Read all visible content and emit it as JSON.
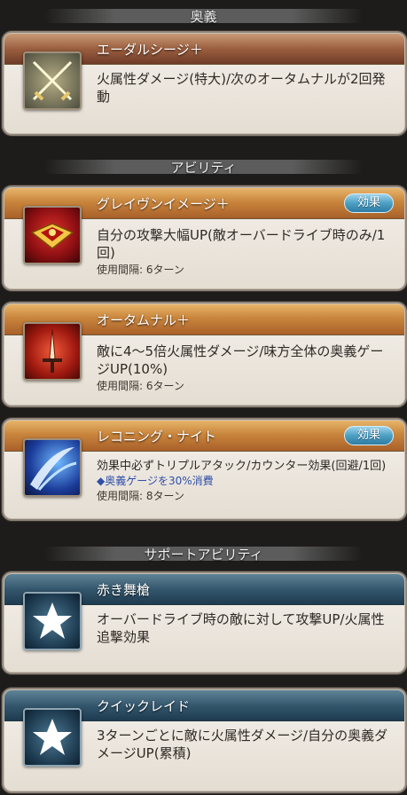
{
  "sections": {
    "ougi": "奥義",
    "abilities": "アビリティ",
    "support": "サポートアビリティ"
  },
  "ougi": {
    "name": "エーダルシージ＋",
    "desc": "火属性ダメージ(特大)/次のオータムナルが2回発動",
    "icon": "crossed-swords-icon"
  },
  "abilities": [
    {
      "name": "グレイヴンイメージ＋",
      "effect_label": "効果",
      "desc": "自分の攻撃大幅UP(敵オーバードライブ時のみ/1回)",
      "cooldown": "使用間隔: 6ターン",
      "icon": "crimson-emblem-icon"
    },
    {
      "name": "オータムナル＋",
      "desc": "敵に4〜5倍火属性ダメージ/味方全体の奥義ゲージUP(10%)",
      "cooldown": "使用間隔: 6ターン",
      "icon": "flame-sword-icon"
    },
    {
      "name": "レコニング・ナイト",
      "effect_label": "効果",
      "desc": "効果中必ずトリプルアタック/カウンター効果(回避/1回)",
      "note": "◆奥義ゲージを30%消費",
      "cooldown": "使用間隔: 8ターン",
      "icon": "blue-slash-icon"
    }
  ],
  "support": [
    {
      "name": "赤き舞槍",
      "desc": "オーバードライブ時の敵に対して攻撃UP/火属性追撃効果",
      "icon": "star-icon"
    },
    {
      "name": "クイックレイド",
      "desc": "3ターンごとに敵に火属性ダメージ/自分の奥義ダメージUP(累積)",
      "icon": "star-icon"
    }
  ]
}
